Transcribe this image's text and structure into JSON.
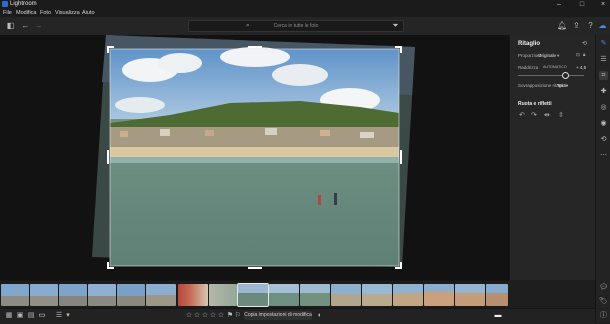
{
  "app": {
    "title": "Lightroom"
  },
  "menu": [
    "File",
    "Modifica",
    "Foto",
    "Visualizza",
    "Aiuto"
  ],
  "search": {
    "placeholder": "Cerca in tutte le foto"
  },
  "panel": {
    "title": "Ritaglio",
    "aspect_label": "Proporzioni",
    "aspect_value": "Originale",
    "straighten_label": "Raddrizza",
    "straighten_sub": "AUTOMATICO",
    "straighten_value": "+ 4,5",
    "straighten_fraction": 0.71,
    "overlay_label": "Sovrapposizione ritaglio",
    "overlay_value": "Terzi",
    "rotate_title": "Ruota e rifletti"
  },
  "bottom": {
    "copy_label": "Copia impostazioni di modifica"
  },
  "colors": {
    "accent": "#2b6bd6",
    "panel_bg": "#262626",
    "canvas_bg": "#121212"
  }
}
